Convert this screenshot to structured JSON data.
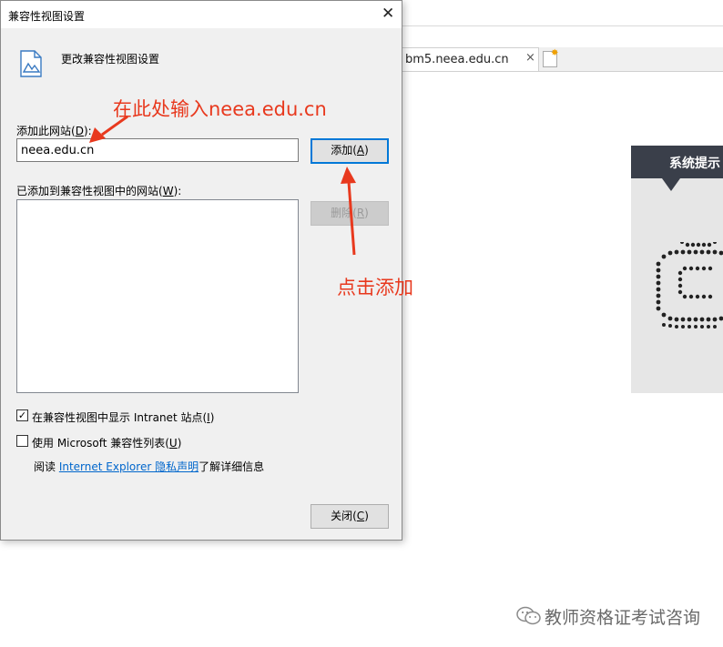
{
  "browser": {
    "tab_label": "bm5.neea.edu.cn",
    "tab_close": "×"
  },
  "system_panel": {
    "title": "系统提示"
  },
  "dialog": {
    "title": "兼容性视图设置",
    "close_glyph": "✕",
    "header_text": "更改兼容性视图设置",
    "add_label_prefix": "添加此网站(",
    "add_label_key": "D",
    "add_label_suffix": "):",
    "site_input_value": "neea.edu.cn",
    "add_button_prefix": "添加(",
    "add_button_key": "A",
    "add_button_suffix": ")",
    "list_label_prefix": "已添加到兼容性视图中的网站(",
    "list_label_key": "W",
    "list_label_suffix": "):",
    "remove_button_prefix": "删除(",
    "remove_button_key": "R",
    "remove_button_suffix": ")",
    "intranet_checkbox_checked": true,
    "intranet_label_prefix": "在兼容性视图中显示 Intranet 站点(",
    "intranet_label_key": "I",
    "intranet_label_suffix": ")",
    "mslist_checkbox_checked": false,
    "mslist_label_prefix": "使用 Microsoft 兼容性列表(",
    "mslist_label_key": "U",
    "mslist_label_suffix": ")",
    "read_prefix": "阅读 ",
    "privacy_link": "Internet Explorer 隐私声明",
    "read_suffix": "了解详细信息",
    "close_button_prefix": "关闭(",
    "close_button_key": "C",
    "close_button_suffix": ")"
  },
  "annotations": {
    "input_hint": "在此处输入neea.edu.cn",
    "click_hint": "点击添加",
    "color": "#e8391e"
  },
  "watermark": {
    "text": "教师资格证考试咨询"
  }
}
